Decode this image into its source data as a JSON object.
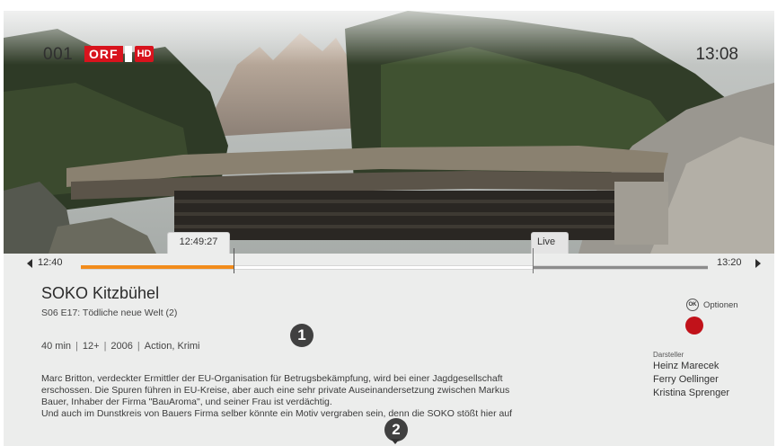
{
  "header": {
    "channel_number": "001",
    "channel_logo_text": "ORF",
    "hd_label": "HD",
    "time": "13:08"
  },
  "timeline": {
    "start_time": "12:40",
    "end_time": "13:20",
    "current_position_label": "12:49:27",
    "live_label": "Live",
    "watched_fraction": 0.244,
    "live_fraction": 0.721
  },
  "program": {
    "title": "SOKO Kitzbühel",
    "subtitle": "S06 E17: Tödliche neue Welt (2)",
    "duration": "40 min",
    "age_rating": "12+",
    "year": "2006",
    "genre": "Action, Krimi",
    "description": "Marc Britton, verdeckter Ermittler der EU-Organisation für Betrugsbekämpfung, wird bei einer Jagdgesellschaft\nerschossen. Die Spuren führen in EU-Kreise, aber auch eine sehr private Auseinandersetzung zwischen Markus\nBauer, Inhaber der Firma \"BauAroma\", und seiner Frau ist verdächtig.\nUnd auch im Dunstkreis von Bauers Firma selber könnte ein Motiv vergraben sein, denn die SOKO stößt hier auf"
  },
  "actions": {
    "ok_key_label": "OK",
    "options_label": "Optionen",
    "record_color": "#c1121a"
  },
  "cast": {
    "label": "Darsteller",
    "members": [
      "Heinz Marecek",
      "Ferry Oellinger",
      "Kristina Sprenger"
    ]
  },
  "callouts": {
    "marker_1": "1",
    "marker_2": "2"
  },
  "colors": {
    "accent_orange": "#f28c1b",
    "brand_red": "#d8131d"
  }
}
